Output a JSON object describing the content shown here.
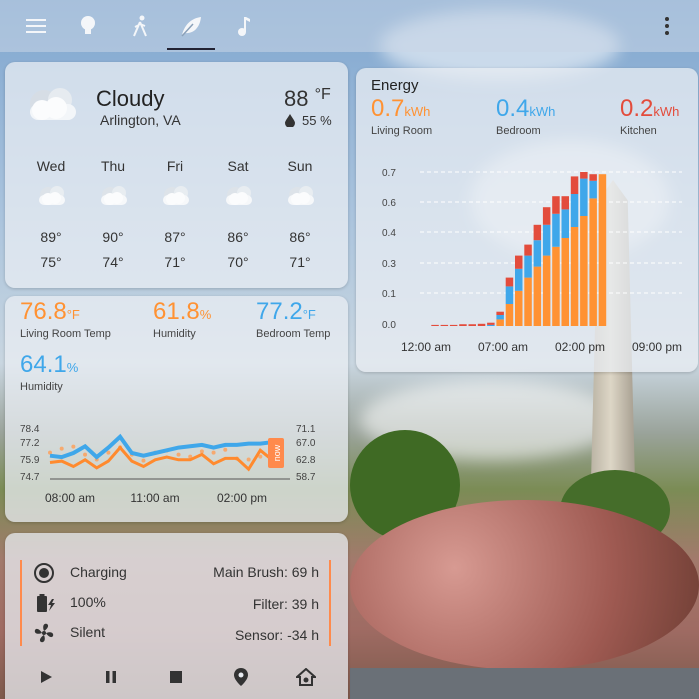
{
  "colors": {
    "orange": "#ff9233",
    "blue": "#3fa7ea",
    "red": "#e34c3c",
    "accent_line": "#ff8a4c"
  },
  "topbar": {
    "icons": [
      "menu-icon",
      "lightbulb-icon",
      "walking-person-icon",
      "leaf-icon",
      "music-note-icon",
      "more-vert-icon"
    ],
    "active_tab": "leaf-icon"
  },
  "weather": {
    "condition": "Cloudy",
    "location": "Arlington, VA",
    "temperature": "88",
    "temp_unit": "°F",
    "humidity": "55 %",
    "forecast": [
      {
        "day": "Wed",
        "high": "89°",
        "low": "75°"
      },
      {
        "day": "Thu",
        "high": "90°",
        "low": "74°"
      },
      {
        "day": "Fri",
        "high": "87°",
        "low": "71°"
      },
      {
        "day": "Sat",
        "high": "86°",
        "low": "70°"
      },
      {
        "day": "Sun",
        "high": "86°",
        "low": "71°"
      }
    ]
  },
  "sensors": {
    "items": [
      {
        "value": "76.8",
        "unit": "°F",
        "label": "Living Room Temp",
        "color": "#ff9233"
      },
      {
        "value": "61.8",
        "unit": "%",
        "label": "Humidity",
        "color": "#ff9233"
      },
      {
        "value": "77.2",
        "unit": "°F",
        "label": "Bedroom Temp",
        "color": "#3fa7ea"
      },
      {
        "value": "64.1",
        "unit": "%",
        "label": "Humidity",
        "color": "#3fa7ea"
      }
    ],
    "chart": {
      "y_left": [
        "78.4",
        "77.2",
        "75.9",
        "74.7"
      ],
      "y_right": [
        "71.1",
        "67.0",
        "62.8",
        "58.7"
      ],
      "x_labels": [
        "08:00 am",
        "11:00 am",
        "02:00 pm"
      ],
      "now_label": "now",
      "temp_blue": [
        76.2,
        76.1,
        76.4,
        76.9,
        76.1,
        76.8,
        77.6,
        76.4,
        76.2,
        76.4,
        76.6,
        76.8,
        76.9,
        77.0,
        76.8,
        77.0,
        77.0,
        77.1,
        77.1,
        77.2
      ],
      "temp_orange": [
        75.7,
        75.8,
        75.4,
        75.9,
        75.3,
        75.8,
        76.8,
        75.8,
        75.4,
        75.9,
        76.1,
        75.9,
        75.9,
        76.3,
        75.6,
        76.0,
        76.0,
        75.2,
        76.6,
        75.9
      ],
      "hum_dots": [
        64.5,
        65.5,
        66.0,
        64.0,
        62.8,
        64.5,
        65.8,
        64.0,
        62.5,
        64.5,
        65.0,
        64.0,
        63.5,
        64.8,
        64.5,
        65.2,
        63.0,
        62.8,
        63.5,
        64.0
      ]
    }
  },
  "vacuum": {
    "status": "Charging",
    "battery": "100%",
    "fan": "Silent",
    "main_brush": "Main Brush: 69 h",
    "filter": "Filter: 39 h",
    "sensor": "Sensor: -34 h",
    "controls": [
      "play-icon",
      "pause-icon",
      "stop-icon",
      "locate-icon",
      "return-home-icon"
    ]
  },
  "energy": {
    "title": "Energy",
    "items": [
      {
        "value": "0.7",
        "unit": "kWh",
        "label": "Living Room",
        "color": "#ff9233"
      },
      {
        "value": "0.4",
        "unit": "kWh",
        "label": "Bedroom",
        "color": "#3fa7ea"
      },
      {
        "value": "0.2",
        "unit": "kWh",
        "label": "Kitchen",
        "color": "#e34c3c"
      }
    ],
    "chart_data": {
      "type": "bar",
      "stacked": true,
      "ylim": [
        0,
        0.7
      ],
      "y_ticks": [
        "0.7",
        "0.6",
        "0.4",
        "0.3",
        "0.1",
        "0.0"
      ],
      "x_labels": [
        "12:00 am",
        "07:00 am",
        "02:00 pm",
        "09:00 pm"
      ],
      "series": [
        {
          "name": "Living Room",
          "values": [
            0.0,
            0.0,
            0.0,
            0.0,
            0.0,
            0.0,
            0.0,
            0.0,
            0.03,
            0.1,
            0.16,
            0.22,
            0.27,
            0.32,
            0.36,
            0.4,
            0.45,
            0.5,
            0.58,
            0.69
          ]
        },
        {
          "name": "Bedroom",
          "values": [
            0.0,
            0.0,
            0.0,
            0.0,
            0.0,
            0.0,
            0.0,
            0.005,
            0.02,
            0.08,
            0.1,
            0.1,
            0.12,
            0.14,
            0.15,
            0.13,
            0.15,
            0.17,
            0.08,
            0.0
          ]
        },
        {
          "name": "Kitchen",
          "values": [
            0.0,
            0.005,
            0.005,
            0.005,
            0.008,
            0.008,
            0.01,
            0.01,
            0.015,
            0.04,
            0.06,
            0.05,
            0.07,
            0.08,
            0.08,
            0.06,
            0.08,
            0.03,
            0.03,
            0.0
          ]
        }
      ]
    }
  }
}
